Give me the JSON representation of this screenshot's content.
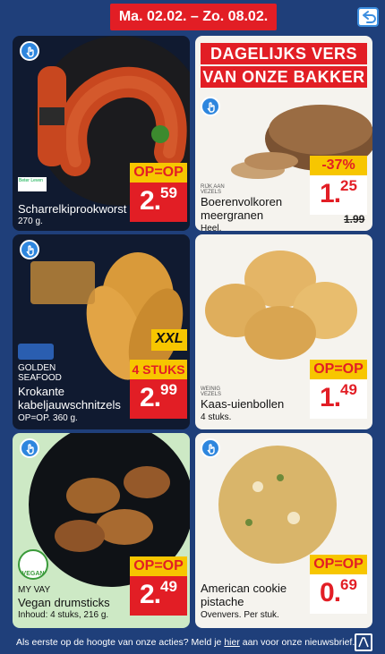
{
  "header": {
    "date_range": "Ma. 02.02. – Zo. 08.02."
  },
  "bakery_banner": {
    "line1": "DAGELIJKS VERS",
    "line2": "VAN ONZE BAKKER"
  },
  "products": [
    {
      "name": "Scharrelkiprookworst",
      "desc": "270 g.",
      "badge": "OP=OP",
      "price_main": "2.",
      "price_cents": "59",
      "eco_label": "Beter Leven"
    },
    {
      "name": "Boerenvolkoren meergranen",
      "desc": "Heel.",
      "badge": "-37%",
      "price_main": "1.",
      "price_cents": "25",
      "old_price": "1.99",
      "small_label": "RIJK AAN VEZELS"
    },
    {
      "brand_line1": "GOLDEN",
      "brand_line2": "SEAFOOD",
      "name": "Krokante kabeljauwschnitzels",
      "desc": "OP=OP. 360 g.",
      "badge_size": "XXL",
      "badge": "4 STUKS",
      "price_main": "2.",
      "price_cents": "99"
    },
    {
      "name": "Kaas-uienbollen",
      "desc": "4 stuks.",
      "badge": "OP=OP",
      "price_main": "1.",
      "price_cents": "49",
      "small_label": "WEINIG VEZELS"
    },
    {
      "brand": "MY VAY",
      "name": "Vegan drumsticks",
      "desc": "Inhoud: 4 stuks, 216 g.",
      "badge": "OP=OP",
      "price_main": "2.",
      "price_cents": "49",
      "vegan_label": "VEGAN"
    },
    {
      "name": "American cookie pistache",
      "desc": "Ovenvers. Per stuk.",
      "badge": "OP=OP",
      "price_main": "0.",
      "price_cents": "69"
    }
  ],
  "footer": {
    "text_before": "Als eerste op de hoogte van onze acties? Meld je ",
    "link": "hier",
    "text_after": " aan voor onze nieuwsbrief."
  },
  "colors": {
    "background": "#1f3f7a",
    "aldi_red": "#e21e25",
    "badge_yellow": "#f7c600",
    "hand_blue": "#2e86de"
  }
}
